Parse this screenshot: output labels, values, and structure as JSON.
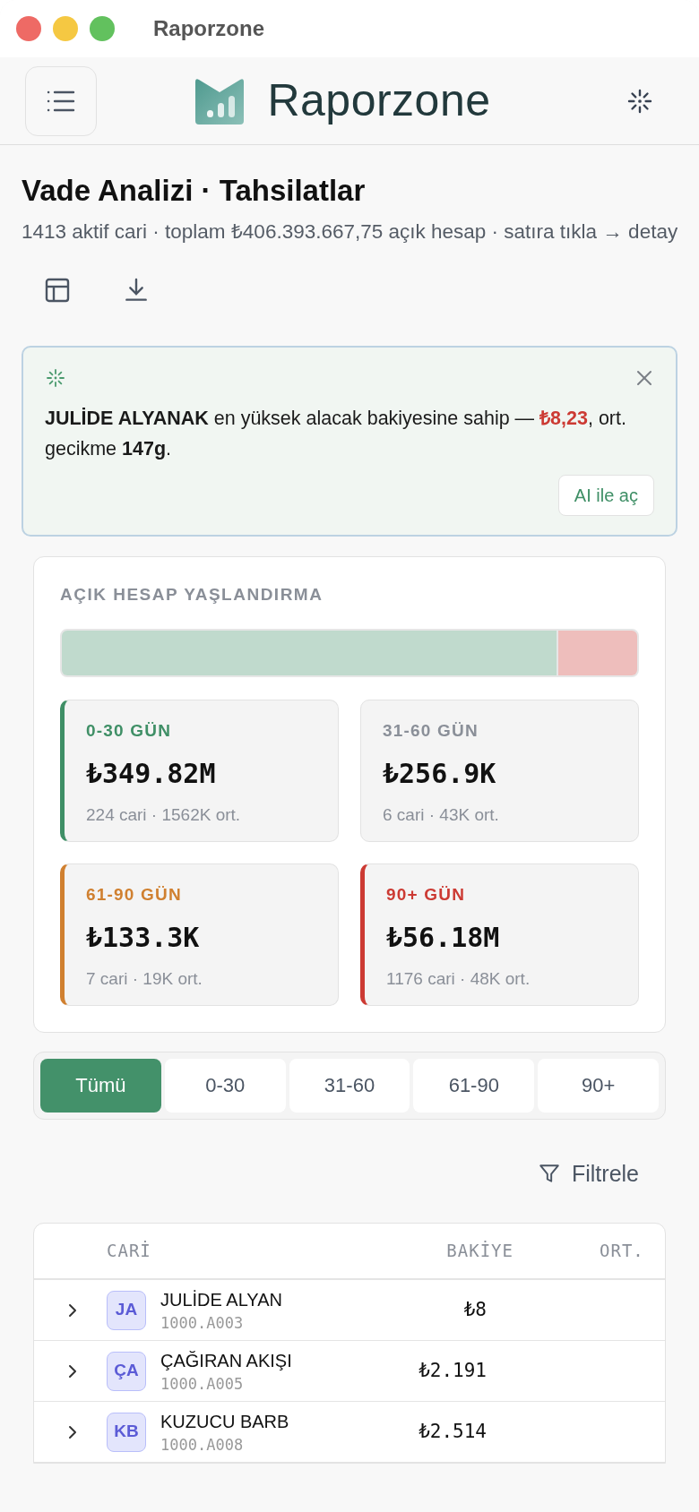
{
  "window": {
    "title": "Raporzone"
  },
  "header": {
    "brand": "Raporzone"
  },
  "page": {
    "title": "Vade Analizi · Tahsilatlar",
    "subtitle": "1413 aktif cari · toplam ₺406.393.667,75 açık hesap · satıra tıkla → detay"
  },
  "insight": {
    "message": [
      {
        "kind": "strong",
        "text": "JULİDE ALYANAK"
      },
      {
        "kind": "plain",
        "text": " en yüksek alacak bakiyesine sahip — "
      },
      {
        "kind": "amount",
        "text": "₺8,23"
      },
      {
        "kind": "plain",
        "text": ", ort. gecikme "
      },
      {
        "kind": "strong",
        "text": "147g"
      },
      {
        "kind": "plain",
        "text": "."
      }
    ],
    "action": "AI ile aç"
  },
  "aging": {
    "title": "AÇIK HESAP YAŞLANDIRMA",
    "buckets": [
      {
        "label": "0-30 GÜN",
        "amount": "₺349.82M",
        "detail": "224 cari · 1562K ort.",
        "color": "#3f8f66",
        "level": 0.862,
        "accent": true
      },
      {
        "label": "31-60 GÜN",
        "amount": "₺256.9K",
        "detail": "6 cari · 43K ort.",
        "color": "#8a8f98",
        "accent": false
      },
      {
        "label": "61-90 GÜN",
        "amount": "₺133.3K",
        "detail": "7 cari · 19K ort.",
        "color": "#d08030",
        "accent": true
      },
      {
        "label": "90+ GÜN",
        "amount": "₺56.18M",
        "detail": "1176 cari · 48K ort.",
        "color": "#cc3a33",
        "level": 0.138,
        "accent": true
      }
    ]
  },
  "tabs": [
    {
      "label": "Tümü",
      "selected": true
    },
    {
      "label": "0-30",
      "selected": false
    },
    {
      "label": "31-60",
      "selected": false
    },
    {
      "label": "61-90",
      "selected": false
    },
    {
      "label": "90+",
      "selected": false
    }
  ],
  "filter": {
    "label": "Filtrele"
  },
  "table": {
    "columns": [
      "CARİ",
      "BAKİYE",
      "ORT."
    ],
    "rows": [
      {
        "initials": "JA",
        "name": "JULİDE ALYAN",
        "code": "1000.A003",
        "balance": "₺8"
      },
      {
        "initials": "ÇA",
        "name": "ÇAĞIRAN AKIŞI",
        "code": "1000.A005",
        "balance": "₺2.191"
      },
      {
        "initials": "KB",
        "name": "KUZUCU BARB",
        "code": "1000.A008",
        "balance": "₺2.514"
      }
    ]
  }
}
